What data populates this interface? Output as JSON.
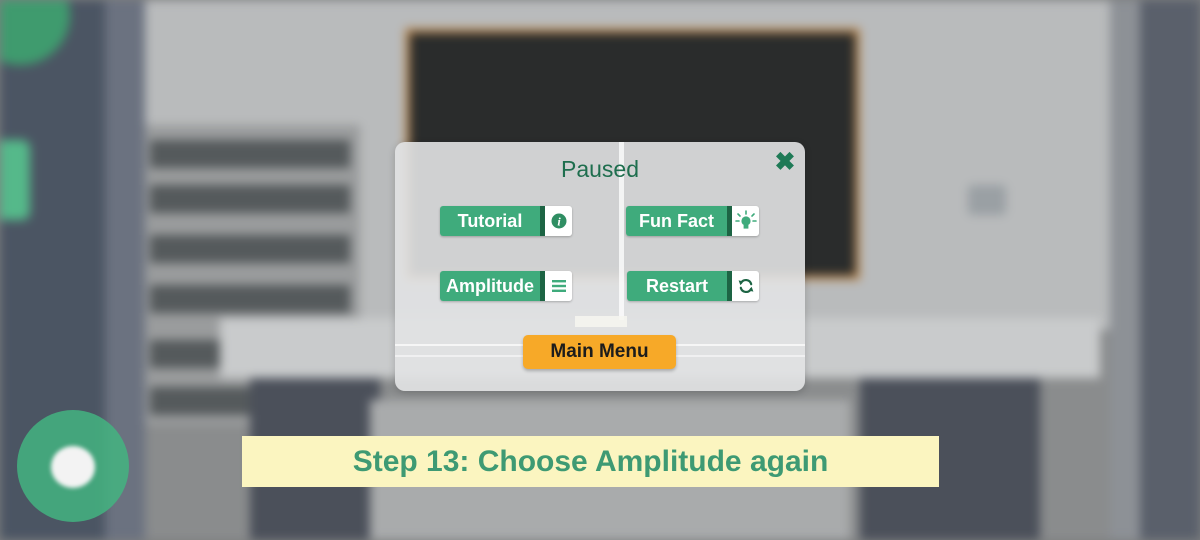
{
  "pause_menu": {
    "title": "Paused",
    "close_icon": "close-x-icon",
    "buttons": {
      "tutorial": {
        "label": "Tutorial",
        "icon": "info-icon"
      },
      "fun_fact": {
        "label": "Fun Fact",
        "icon": "lightbulb-icon"
      },
      "amplitude": {
        "label": "Amplitude",
        "icon": "menu-lines-icon"
      },
      "restart": {
        "label": "Restart",
        "icon": "refresh-icon"
      }
    },
    "main_menu_label": "Main Menu"
  },
  "caption": {
    "text": "Step 13: Choose Amplitude again"
  },
  "colors": {
    "button_green": "#3fab7c",
    "button_dark_green": "#1d6444",
    "main_menu_orange": "#f7a928",
    "caption_background": "#fbf5c0",
    "caption_text": "#3e9a73"
  }
}
